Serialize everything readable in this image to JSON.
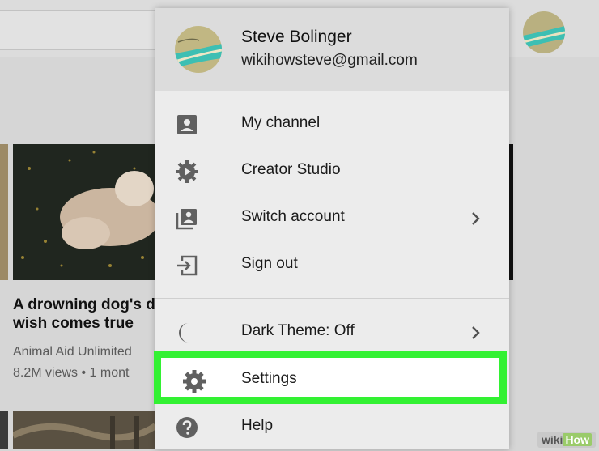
{
  "account": {
    "name": "Steve Bolinger",
    "email": "wikihowsteve@gmail.com"
  },
  "menu": {
    "items": [
      {
        "label": "My channel",
        "icon": "person-box-icon"
      },
      {
        "label": "Creator Studio",
        "icon": "gear-play-icon"
      },
      {
        "label": "Switch account",
        "icon": "switch-account-icon",
        "has_submenu": true
      },
      {
        "label": "Sign out",
        "icon": "sign-out-icon"
      },
      {
        "label": "Dark Theme: Off",
        "icon": "moon-icon",
        "has_submenu": true
      },
      {
        "label": "Settings",
        "icon": "gear-icon",
        "highlighted": true
      },
      {
        "label": "Help",
        "icon": "help-icon"
      }
    ]
  },
  "background_video": {
    "title_line1": "A drowning dog's do",
    "title_line2": "wish comes true",
    "channel": "Animal Aid Unlimited",
    "meta": "8.2M views • 1 mont"
  },
  "watermark": {
    "part1": "wiki",
    "part2": "How"
  },
  "colors": {
    "highlight": "#33f133",
    "menu_bg": "#ececec",
    "header_bg": "#dcdcdc"
  }
}
